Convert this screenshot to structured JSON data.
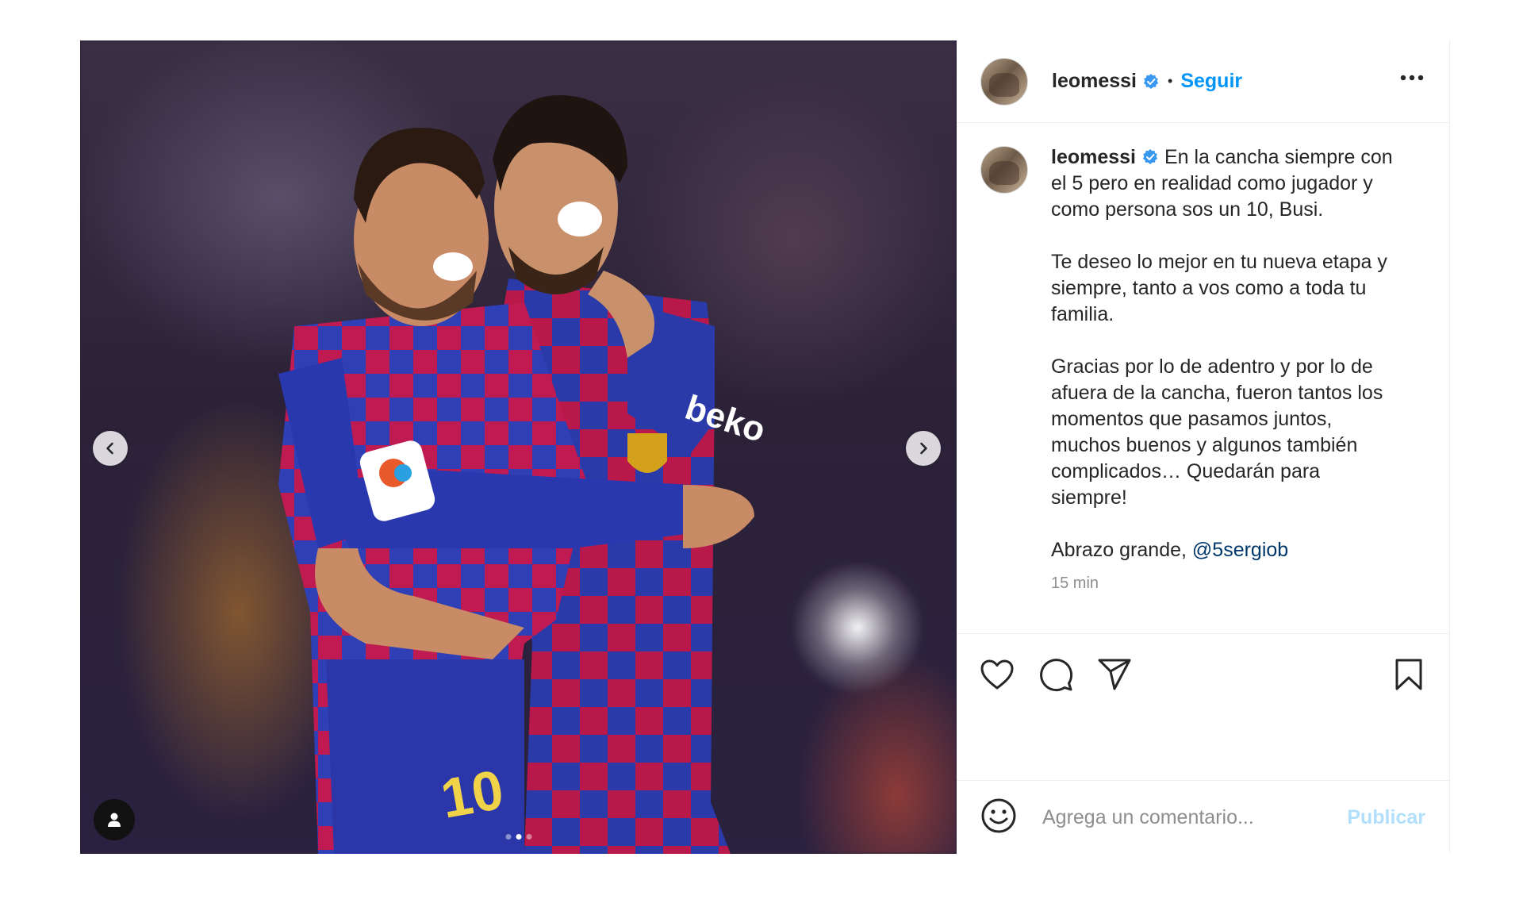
{
  "media": {
    "slides_count": 3,
    "active_slide_index": 1
  },
  "header": {
    "username": "leomessi",
    "separator": "•",
    "follow_label": "Seguir"
  },
  "caption": {
    "username": "leomessi",
    "text": "En la cancha siempre con el 5 pero en realidad como jugador y como persona sos un 10, Busi.\n\nTe deseo lo mejor en tu nueva etapa y siempre, tanto a vos como a toda tu familia.\n\nGracias por lo de adentro y por lo de afuera de la cancha, fueron tantos los momentos que pasamos juntos, muchos buenos y algunos también complicados… Quedarán para siempre!\n\nAbrazo grande, ",
    "mention": "@5sergiob",
    "timestamp": "15 min"
  },
  "comment": {
    "placeholder": "Agrega un comentario...",
    "publish_label": "Publicar"
  },
  "colors": {
    "accent": "#0095f6",
    "verified": "#3897f0",
    "publish_disabled": "#b2dffc",
    "mention": "#00376b"
  },
  "icons": {
    "verified": "verified-badge-icon",
    "more": "more-options-icon",
    "like": "heart-icon",
    "comment": "comment-bubble-icon",
    "share": "paper-plane-icon",
    "save": "bookmark-icon",
    "emoji": "smiley-icon",
    "tags": "user-tag-icon",
    "prev": "chevron-left-icon",
    "next": "chevron-right-icon"
  }
}
